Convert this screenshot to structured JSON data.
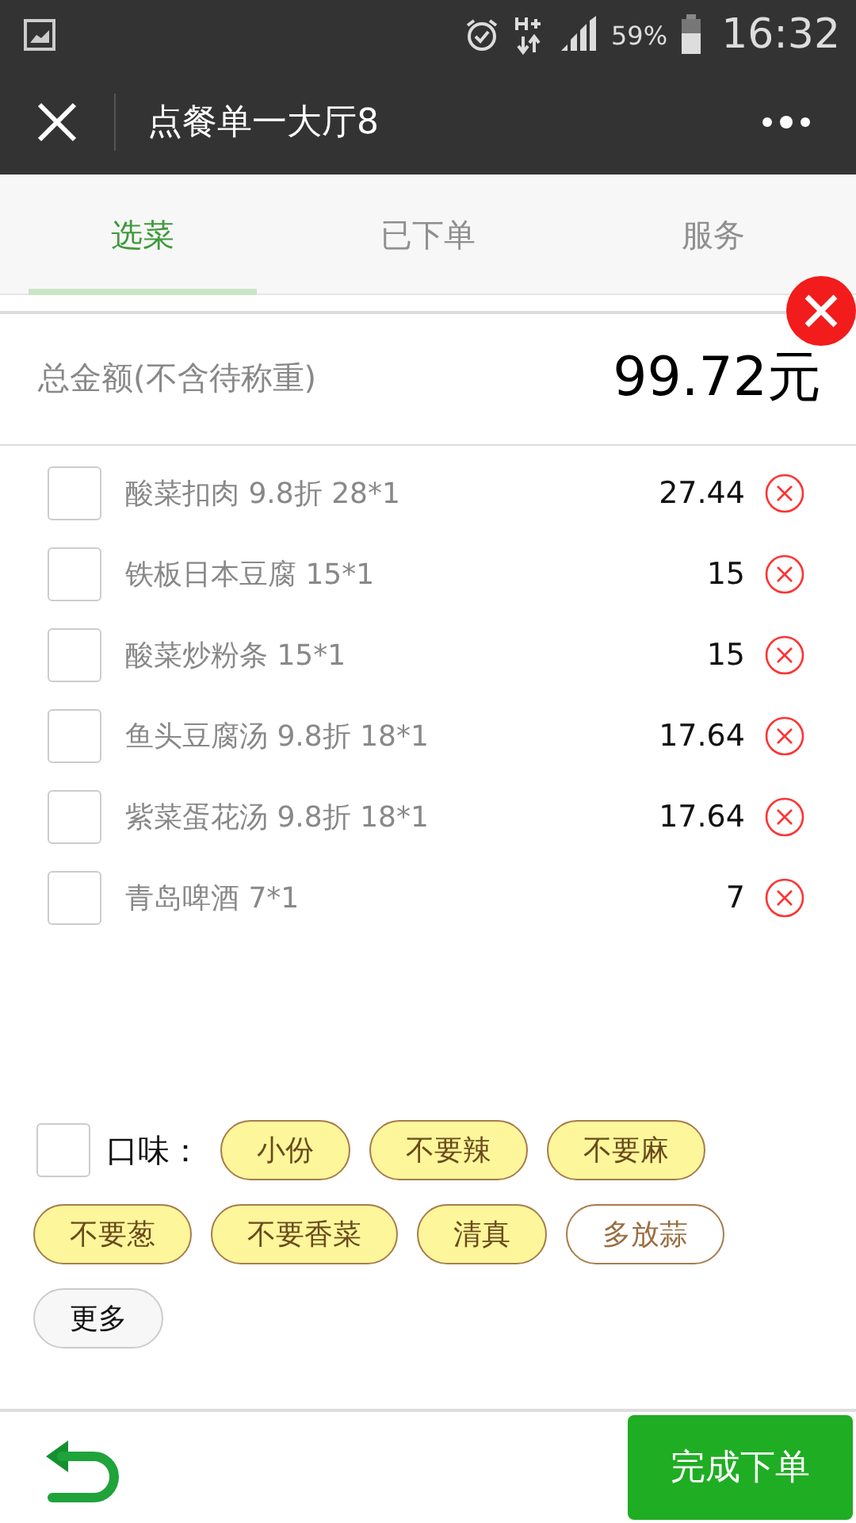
{
  "status_bar": {
    "battery": "59%",
    "time": "16:32"
  },
  "nav": {
    "title": "点餐单一大厅8"
  },
  "tabs": [
    {
      "label": "选菜",
      "selected": true
    },
    {
      "label": "已下单",
      "selected": false
    },
    {
      "label": "服务",
      "selected": false
    }
  ],
  "total": {
    "label": "总金额(不含待称重)",
    "amount": "99.72元"
  },
  "items": [
    {
      "name": "酸菜扣肉 9.8折 28*1",
      "price": "27.44",
      "checked": false
    },
    {
      "name": "铁板日本豆腐 15*1",
      "price": "15",
      "checked": false
    },
    {
      "name": "酸菜炒粉条 15*1",
      "price": "15",
      "checked": false
    },
    {
      "name": "鱼头豆腐汤 9.8折 18*1",
      "price": "17.64",
      "checked": false
    },
    {
      "name": "紫菜蛋花汤 9.8折 18*1",
      "price": "17.64",
      "checked": false
    },
    {
      "name": "青岛啤酒 7*1",
      "price": "7",
      "checked": false
    }
  ],
  "taste": {
    "checked": false,
    "label": "口味：",
    "tags": [
      {
        "label": "小份",
        "kind": "tag",
        "selected": true
      },
      {
        "label": "不要辣",
        "kind": "tag",
        "selected": true
      },
      {
        "label": "不要麻",
        "kind": "tag",
        "selected": true
      },
      {
        "label": "不要葱",
        "kind": "tag",
        "selected": true
      },
      {
        "label": "不要香菜",
        "kind": "tag",
        "selected": true
      },
      {
        "label": "清真",
        "kind": "tag",
        "selected": true
      },
      {
        "label": "多放蒜",
        "kind": "tag",
        "selected": false
      },
      {
        "label": "更多",
        "kind": "more",
        "selected": false
      }
    ]
  },
  "footer": {
    "submit": "完成下单"
  }
}
